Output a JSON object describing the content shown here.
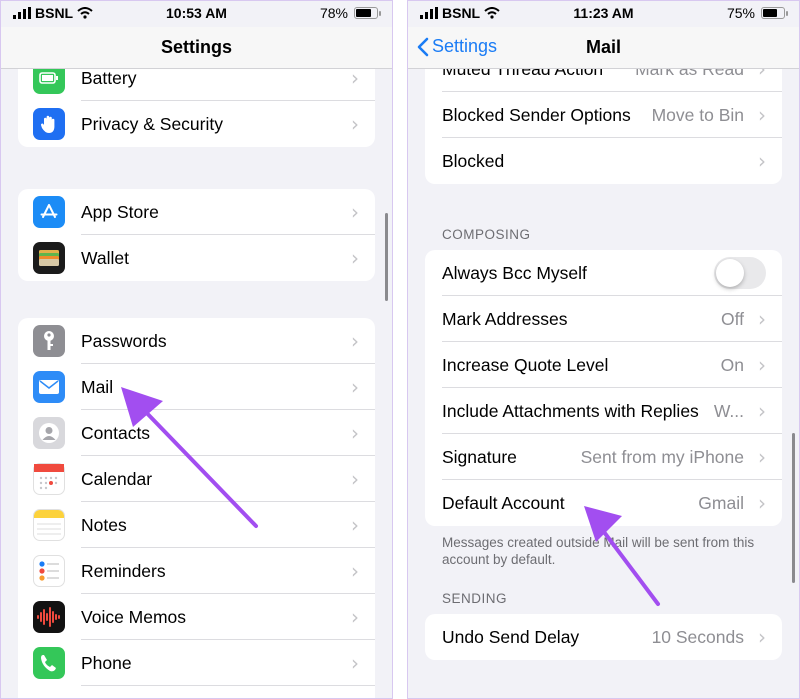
{
  "left": {
    "status": {
      "carrier": "BSNL",
      "time": "10:53 AM",
      "battery": "78%",
      "battery_level": 0.78
    },
    "title": "Settings",
    "groups": [
      {
        "items": [
          {
            "label": "Battery",
            "icon": "battery-icon"
          },
          {
            "label": "Privacy & Security",
            "icon": "hand-icon"
          }
        ]
      },
      {
        "items": [
          {
            "label": "App Store",
            "icon": "app-store-icon"
          },
          {
            "label": "Wallet",
            "icon": "wallet-icon"
          }
        ]
      },
      {
        "items": [
          {
            "label": "Passwords",
            "icon": "key-icon"
          },
          {
            "label": "Mail",
            "icon": "mail-icon"
          },
          {
            "label": "Contacts",
            "icon": "contacts-icon"
          },
          {
            "label": "Calendar",
            "icon": "calendar-icon"
          },
          {
            "label": "Notes",
            "icon": "notes-icon"
          },
          {
            "label": "Reminders",
            "icon": "reminders-icon"
          },
          {
            "label": "Voice Memos",
            "icon": "voice-memos-icon"
          },
          {
            "label": "Phone",
            "icon": "phone-icon"
          }
        ]
      }
    ]
  },
  "right": {
    "status": {
      "carrier": "BSNL",
      "time": "11:23 AM",
      "battery": "75%",
      "battery_level": 0.75
    },
    "back": "Settings",
    "title": "Mail",
    "top_group": [
      {
        "label": "Muted Thread Action",
        "value": "Mark as Read"
      },
      {
        "label": "Blocked Sender Options",
        "value": "Move to Bin"
      },
      {
        "label": "Blocked",
        "value": ""
      }
    ],
    "composing_header": "COMPOSING",
    "composing": [
      {
        "label": "Always Bcc Myself",
        "toggle": false
      },
      {
        "label": "Mark Addresses",
        "value": "Off"
      },
      {
        "label": "Increase Quote Level",
        "value": "On"
      },
      {
        "label": "Include Attachments with Replies",
        "value": "W..."
      },
      {
        "label": "Signature",
        "value": "Sent from my iPhone"
      },
      {
        "label": "Default Account",
        "value": "Gmail"
      }
    ],
    "composing_footer": "Messages created outside Mail will be sent from this account by default.",
    "sending_header": "SENDING",
    "sending": [
      {
        "label": "Undo Send Delay",
        "value": "10 Seconds"
      }
    ]
  },
  "colors": {
    "accent": "#1a7cf5",
    "arrow": "#a24ef0"
  }
}
